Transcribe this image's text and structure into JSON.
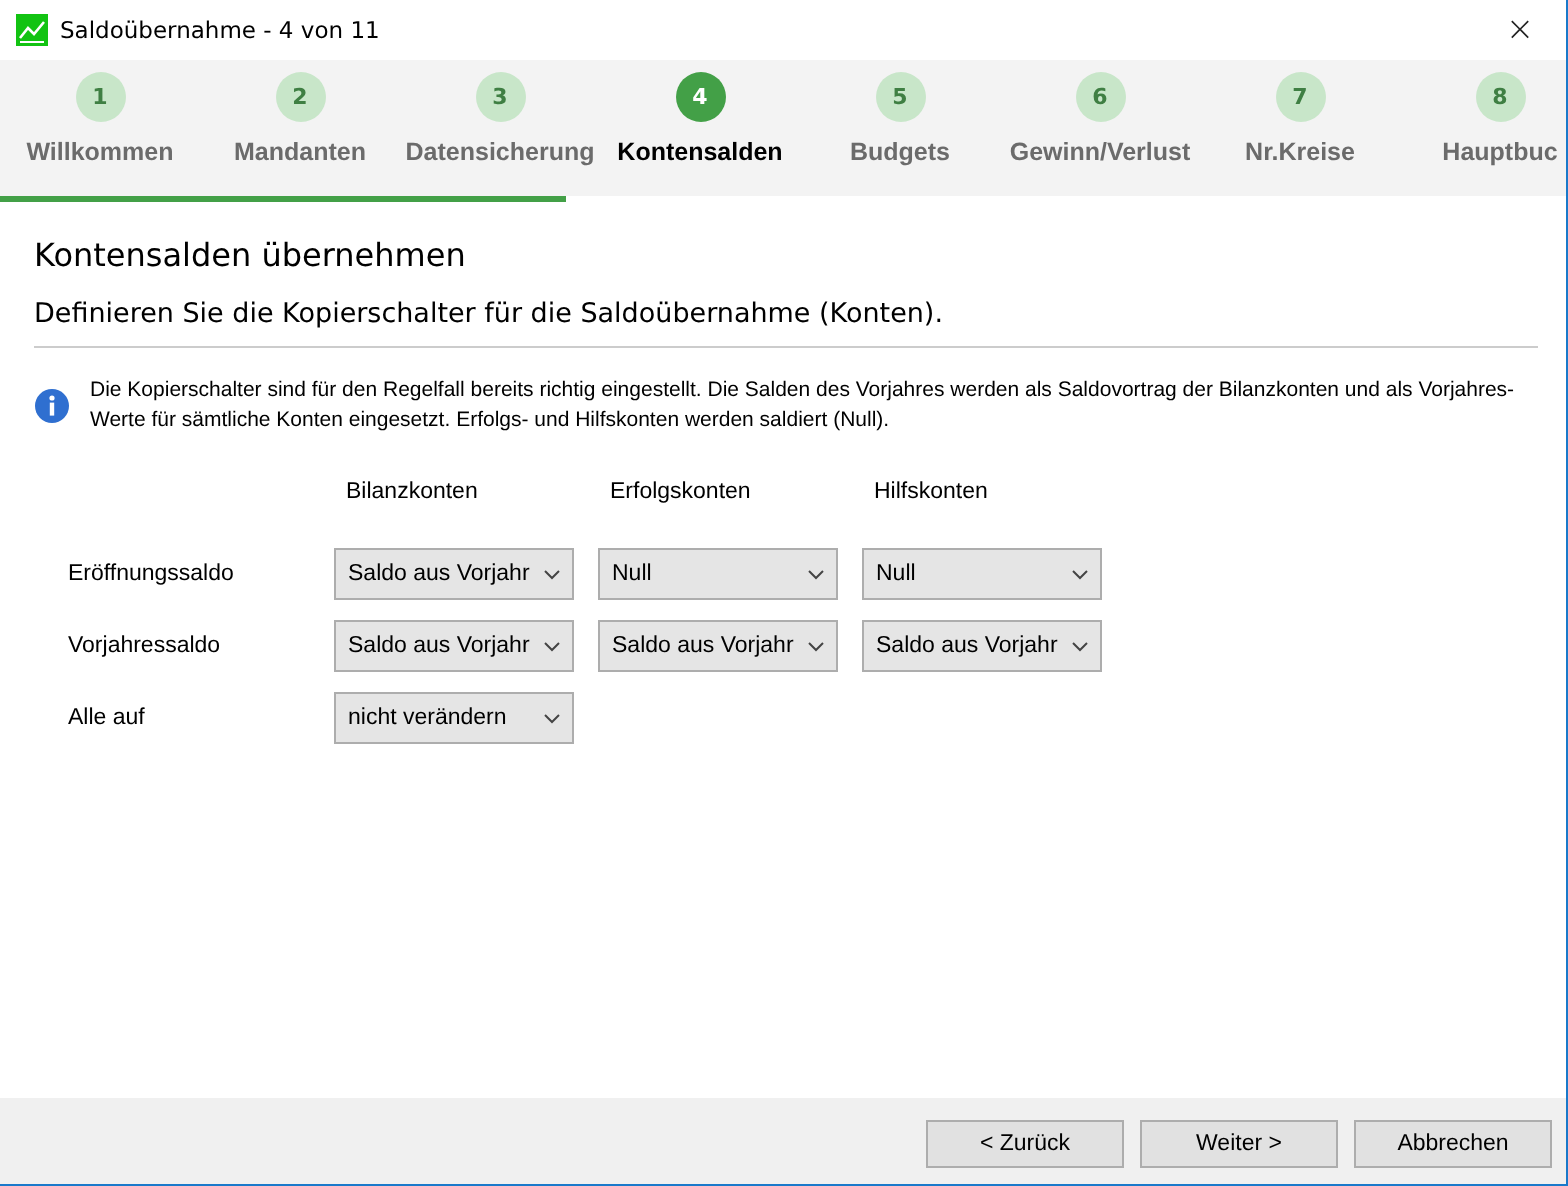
{
  "window": {
    "title": "Saldoübernahme - 4 von 11",
    "close": "×"
  },
  "steps": [
    {
      "number": "1",
      "label": "Willkommen",
      "selected": false
    },
    {
      "number": "2",
      "label": "Mandanten",
      "selected": false
    },
    {
      "number": "3",
      "label": "Datensicherung",
      "selected": false
    },
    {
      "number": "4",
      "label": "Kontensalden",
      "selected": true
    },
    {
      "number": "5",
      "label": "Budgets",
      "selected": false
    },
    {
      "number": "6",
      "label": "Gewinn/Verlust",
      "selected": false
    },
    {
      "number": "7",
      "label": "Nr.Kreise",
      "selected": false
    },
    {
      "number": "8",
      "label": "Hauptbuc",
      "selected": false
    }
  ],
  "progress": {
    "level": 0.362
  },
  "heading": "Kontensalden übernehmen",
  "subtitle": "Definieren Sie die Kopierschalter für die Saldoübernahme (Konten).",
  "info": "Die Kopierschalter sind für den Regelfall bereits richtig eingestellt. Die Salden des Vorjahres werden als Saldovortrag der Bilanzkonten und als Vorjahres-Werte für sämtliche Konten eingesetzt. Erfolgs- und Hilfskonten werden saldiert (Null).",
  "columns": [
    "Bilanzkonten",
    "Erfolgskonten",
    "Hilfskonten"
  ],
  "rows": [
    {
      "label": "Eröffnungssaldo",
      "values": [
        "Saldo aus Vorjahr",
        "Null",
        "Null"
      ]
    },
    {
      "label": "Vorjahressaldo",
      "values": [
        "Saldo aus Vorjahr",
        "Saldo aus Vorjahr",
        "Saldo aus Vorjahr"
      ]
    },
    {
      "label": "Alle auf",
      "values": [
        "nicht verändern"
      ]
    }
  ],
  "buttons": [
    "< Zurück",
    "Weiter >",
    "Abbrechen"
  ]
}
